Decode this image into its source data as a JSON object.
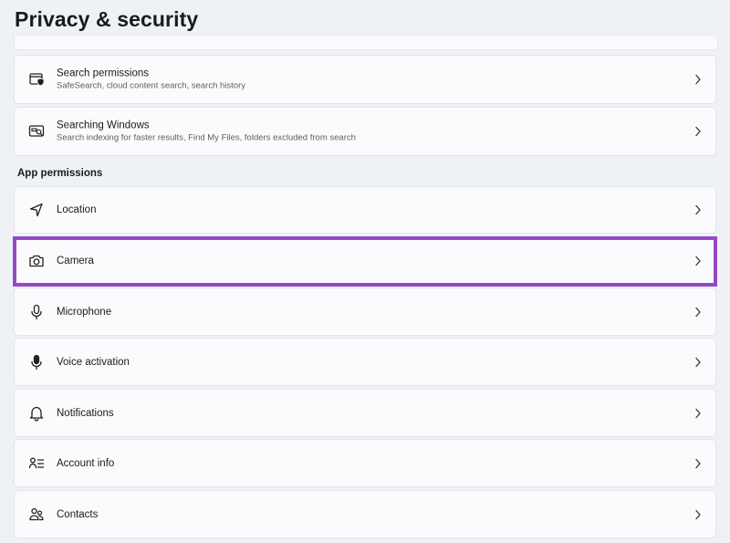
{
  "page": {
    "title": "Privacy & security"
  },
  "search_permissions": {
    "title": "Search permissions",
    "subtitle": "SafeSearch, cloud content search, search history",
    "icon": "search-permissions-icon"
  },
  "searching_windows": {
    "title": "Searching Windows",
    "subtitle": "Search indexing for faster results, Find My Files, folders excluded from search",
    "icon": "searching-windows-icon"
  },
  "app_permissions": {
    "header": "App permissions",
    "items": [
      {
        "label": "Location",
        "icon": "location-icon"
      },
      {
        "label": "Camera",
        "icon": "camera-icon",
        "highlighted": true
      },
      {
        "label": "Microphone",
        "icon": "microphone-icon"
      },
      {
        "label": "Voice activation",
        "icon": "voice-activation-icon"
      },
      {
        "label": "Notifications",
        "icon": "bell-icon"
      },
      {
        "label": "Account info",
        "icon": "account-info-icon"
      },
      {
        "label": "Contacts",
        "icon": "contacts-icon"
      }
    ]
  },
  "colors": {
    "background": "#eef2f7",
    "card": "#fbfbfd",
    "highlight_border": "#9249c4"
  }
}
